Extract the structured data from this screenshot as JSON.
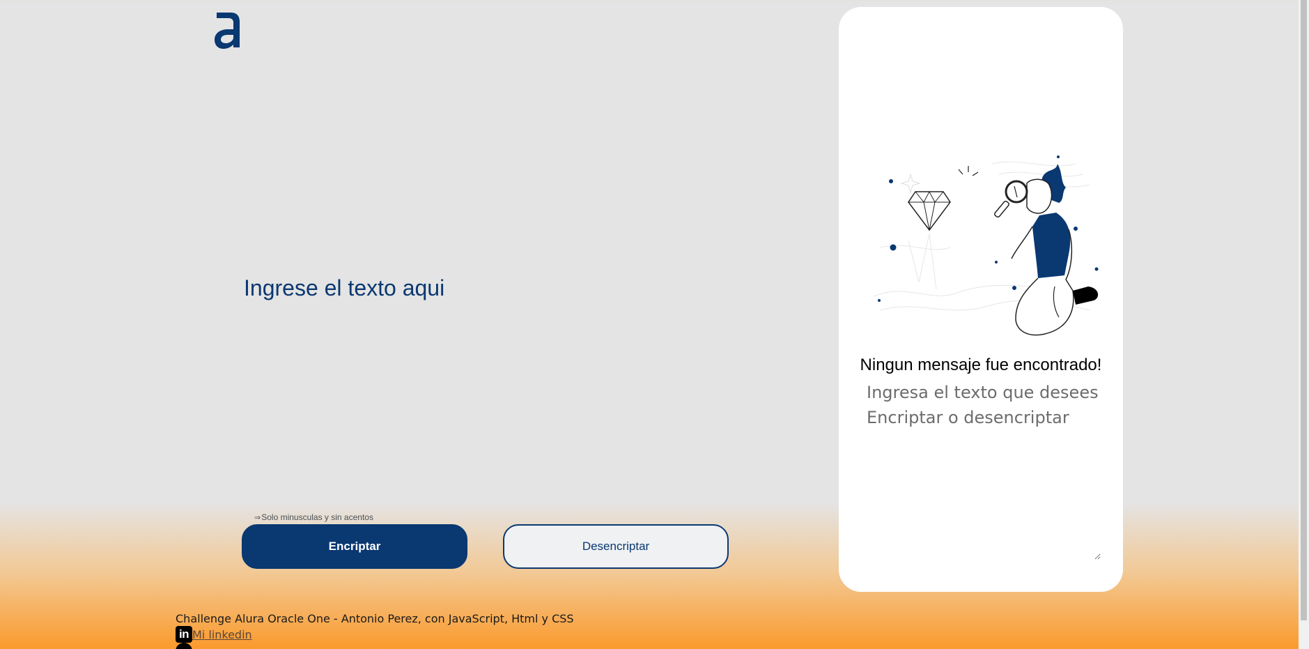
{
  "app": {
    "logo_icon": "alura-a-logo-icon",
    "brand_color": "#0a3871",
    "accent_color": "#fb9a2c"
  },
  "input": {
    "placeholder": "Ingrese el texto aqui",
    "value": ""
  },
  "hint": {
    "icon": "arrow-right-icon",
    "icon_glyph": "⇒",
    "text": "Solo minusculas y sin acentos"
  },
  "buttons": {
    "encrypt_label": "Encriptar",
    "decrypt_label": "Desencriptar"
  },
  "panel": {
    "illustration": "searching-person-illustration",
    "title": "Ningun mensaje fue encontrado!",
    "output_placeholder": "Ingresa el texto que desees\nEncriptar o desencriptar"
  },
  "footer": {
    "credit": "Challenge Alura Oracle One - Antonio Perez, con JavaScript, Html y CSS",
    "linkedin_icon_text": "in",
    "linkedin_label": "Mi linkedin"
  }
}
